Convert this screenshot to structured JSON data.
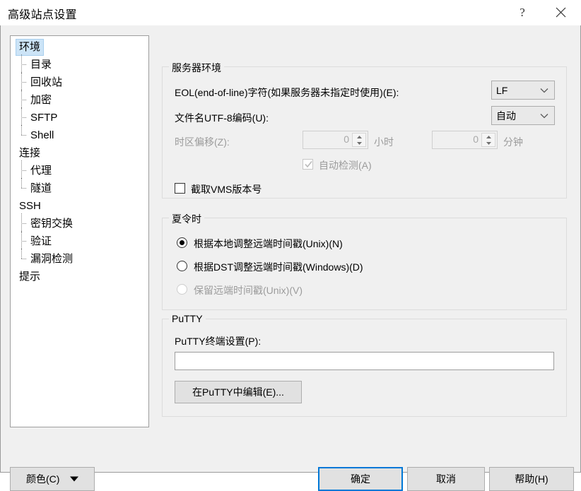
{
  "window": {
    "title": "高级站点设置",
    "help_button": "?",
    "close_button": "✕"
  },
  "sidebar": {
    "items": [
      {
        "label": "环境",
        "level": "root",
        "selected": true
      },
      {
        "label": "目录",
        "level": "child",
        "selected": false
      },
      {
        "label": "回收站",
        "level": "child",
        "selected": false
      },
      {
        "label": "加密",
        "level": "child",
        "selected": false
      },
      {
        "label": "SFTP",
        "level": "child",
        "selected": false
      },
      {
        "label": "Shell",
        "level": "child",
        "selected": false
      },
      {
        "label": "连接",
        "level": "root",
        "selected": false
      },
      {
        "label": "代理",
        "level": "child",
        "selected": false
      },
      {
        "label": "隧道",
        "level": "child",
        "selected": false
      },
      {
        "label": "SSH",
        "level": "root",
        "selected": false
      },
      {
        "label": "密钥交换",
        "level": "child",
        "selected": false
      },
      {
        "label": "验证",
        "level": "child",
        "selected": false
      },
      {
        "label": "漏洞检测",
        "level": "child",
        "selected": false
      },
      {
        "label": "提示",
        "level": "root",
        "selected": false
      }
    ]
  },
  "server_group": {
    "title": "服务器环境",
    "eol_label": "EOL(end-of-line)字符(如果服务器未指定时使用)(E):",
    "eol_value": "LF",
    "utf8_label": "文件名UTF-8编码(U):",
    "utf8_value": "自动",
    "timezone_label": "时区偏移(Z):",
    "hours_value": "0",
    "hours_unit": "小时",
    "minutes_value": "0",
    "minutes_unit": "分钟",
    "autodetect_label": "自动检测(A)",
    "autodetect_checked": true,
    "autodetect_enabled": false,
    "vms_label": "截取VMS版本号",
    "vms_checked": false
  },
  "dst_group": {
    "title": "夏令时",
    "options": [
      {
        "label": "根据本地调整远端时间戳(Unix)(N)",
        "selected": true,
        "enabled": true
      },
      {
        "label": "根据DST调整远端时间戳(Windows)(D)",
        "selected": false,
        "enabled": true
      },
      {
        "label": "保留远端时间戳(Unix)(V)",
        "selected": false,
        "enabled": false
      }
    ]
  },
  "putty_group": {
    "title": "PuTTY",
    "terminal_label": "PuTTY终端设置(P):",
    "terminal_value": "",
    "terminal_placeholder": "",
    "edit_button": "在PuTTY中编辑(E)..."
  },
  "footer": {
    "color_button": "颜色(C)",
    "ok_button": "确定",
    "cancel_button": "取消",
    "help_button": "帮助(H)"
  },
  "colors": {
    "window_bg": "#f0f0f0",
    "accent": "#0078d7",
    "selection": "#cce4f7",
    "disabled_text": "#9b9b9b"
  }
}
